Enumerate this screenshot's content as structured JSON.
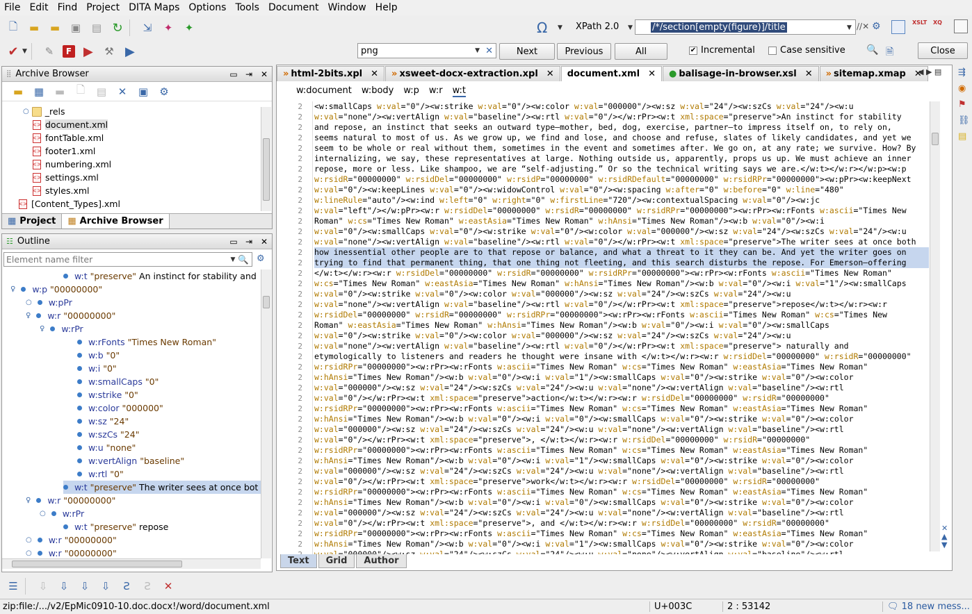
{
  "menu": [
    "File",
    "Edit",
    "Find",
    "Project",
    "DITA Maps",
    "Options",
    "Tools",
    "Document",
    "Window",
    "Help"
  ],
  "toolbar": {
    "xpath_version": "XPath 2.0",
    "xpath_query": "/*/section[empty(figure)]/title"
  },
  "find": {
    "query": "png",
    "next": "Next",
    "previous": "Previous",
    "all": "All",
    "incremental": "Incremental",
    "case_sensitive": "Case sensitive",
    "close": "Close"
  },
  "archive": {
    "title": "Archive Browser",
    "items": [
      "_rels",
      "document.xml",
      "fontTable.xml",
      "footer1.xml",
      "numbering.xml",
      "settings.xml",
      "styles.xml",
      "[Content_Types].xml"
    ],
    "tab_project": "Project",
    "tab_archive": "Archive Browser"
  },
  "outline": {
    "title": "Outline",
    "filter_placeholder": "Element name filter",
    "rows": [
      "w:t \"preserve\" An instinct for stability and",
      "w:p \"00000000\"",
      "w:pPr",
      "w:r \"00000000\"",
      "w:rPr",
      "w:rFonts \"Times New Roman\"",
      "w:b \"0\"",
      "w:i \"0\"",
      "w:smallCaps \"0\"",
      "w:strike \"0\"",
      "w:color \"000000\"",
      "w:sz \"24\"",
      "w:szCs \"24\"",
      "w:u \"none\"",
      "w:vertAlign \"baseline\"",
      "w:rtl \"0\"",
      "w:t \"preserve\" The writer sees at once bot",
      "w:r \"00000000\"",
      "w:rPr",
      "w:t \"preserve\" repose",
      "w:r \"00000000\"",
      "w:r \"00000000\""
    ]
  },
  "editor": {
    "tabs": [
      "html-2bits.xpl",
      "xsweet-docx-extraction.xpl",
      "document.xml",
      "balisage-in-browser.xsl",
      "sitemap.xmap"
    ],
    "breadcrumb": [
      "w:document",
      "w:body",
      "w:p",
      "w:r",
      "w:t"
    ],
    "line_number": "2",
    "mode_tabs": [
      "Text",
      "Grid",
      "Author"
    ],
    "lines": [
      "<w:smallCaps w:val=\"0\"/><w:strike w:val=\"0\"/><w:color w:val=\"000000\"/><w:sz w:val=\"24\"/><w:szCs w:val=\"24\"/><w:u",
      "w:val=\"none\"/><w:vertAlign w:val=\"baseline\"/><w:rtl w:val=\"0\"/></w:rPr><w:t xml:space=\"preserve\">An instinct for stability",
      "and repose, an instinct that seeks an outward type—mother, bed, dog, exercise, partner—to impress itself on, to rely on,",
      "seems natural to most of us. As we grow up, we find and lose, and choose and refuse, slates of likely candidates, and yet we",
      "seem to be whole or real without them, sometimes in the event and sometimes after. We go on, at any rate; we survive. How? By",
      "internalizing, we say, these representatives at large. Nothing outside us, apparently, props us up. We must achieve an inner",
      "repose, more or less. Like shampoo, we are “self-adjusting.” Or so the technical writing says we are.</w:t></w:r></w:p><w:p",
      "w:rsidR=\"00000000\" w:rsidDel=\"00000000\" w:rsidP=\"00000000\" w:rsidRDefault=\"00000000\" w:rsidRPr=\"00000000\"><w:pPr><w:keepNext",
      "w:val=\"0\"/><w:keepLines w:val=\"0\"/><w:widowControl w:val=\"0\"/><w:spacing w:after=\"0\" w:before=\"0\" w:line=\"480\"",
      "w:lineRule=\"auto\"/><w:ind w:left=\"0\" w:right=\"0\" w:firstLine=\"720\"/><w:contextualSpacing w:val=\"0\"/><w:jc",
      "w:val=\"left\"/></w:pPr><w:r w:rsidDel=\"00000000\" w:rsidR=\"00000000\" w:rsidRPr=\"00000000\"><w:rPr><w:rFonts w:ascii=\"Times New",
      "Roman\" w:cs=\"Times New Roman\" w:eastAsia=\"Times New Roman\" w:hAnsi=\"Times New Roman\"/><w:b w:val=\"0\"/><w:i",
      "w:val=\"0\"/><w:smallCaps w:val=\"0\"/><w:strike w:val=\"0\"/><w:color w:val=\"000000\"/><w:sz w:val=\"24\"/><w:szCs w:val=\"24\"/><w:u",
      "w:val=\"none\"/><w:vertAlign w:val=\"baseline\"/><w:rtl w:val=\"0\"/></w:rPr><w:t xml:space=\"preserve\">The writer sees at once both",
      "how inessential other people are to that repose or balance, and what a threat to it they can be. And yet the writer goes on",
      "trying to find that permanent thing, that one thing not fleeting, and this search disturbs the repose. For Emerson—offering",
      "</w:t></w:r><w:r w:rsidDel=\"00000000\" w:rsidR=\"00000000\" w:rsidRPr=\"00000000\"><w:rPr><w:rFonts w:ascii=\"Times New Roman\"",
      "w:cs=\"Times New Roman\" w:eastAsia=\"Times New Roman\" w:hAnsi=\"Times New Roman\"/><w:b w:val=\"0\"/><w:i w:val=\"1\"/><w:smallCaps",
      "w:val=\"0\"/><w:strike w:val=\"0\"/><w:color w:val=\"000000\"/><w:sz w:val=\"24\"/><w:szCs w:val=\"24\"/><w:u",
      "w:val=\"none\"/><w:vertAlign w:val=\"baseline\"/><w:rtl w:val=\"0\"/></w:rPr><w:t xml:space=\"preserve\">repose</w:t></w:r><w:r",
      "w:rsidDel=\"00000000\" w:rsidR=\"00000000\" w:rsidRPr=\"00000000\"><w:rPr><w:rFonts w:ascii=\"Times New Roman\" w:cs=\"Times New",
      "Roman\" w:eastAsia=\"Times New Roman\" w:hAnsi=\"Times New Roman\"/><w:b w:val=\"0\"/><w:i w:val=\"0\"/><w:smallCaps",
      "w:val=\"0\"/><w:strike w:val=\"0\"/><w:color w:val=\"000000\"/><w:sz w:val=\"24\"/><w:szCs w:val=\"24\"/><w:u",
      "w:val=\"none\"/><w:vertAlign w:val=\"baseline\"/><w:rtl w:val=\"0\"/></w:rPr><w:t xml:space=\"preserve\"> naturally and",
      "etymologically to listeners and readers he thought were insane with </w:t></w:r><w:r w:rsidDel=\"00000000\" w:rsidR=\"00000000\"",
      "w:rsidRPr=\"00000000\"><w:rPr><w:rFonts w:ascii=\"Times New Roman\" w:cs=\"Times New Roman\" w:eastAsia=\"Times New Roman\"",
      "w:hAnsi=\"Times New Roman\"/><w:b w:val=\"0\"/><w:i w:val=\"1\"/><w:smallCaps w:val=\"0\"/><w:strike w:val=\"0\"/><w:color",
      "w:val=\"000000\"/><w:sz w:val=\"24\"/><w:szCs w:val=\"24\"/><w:u w:val=\"none\"/><w:vertAlign w:val=\"baseline\"/><w:rtl",
      "w:val=\"0\"/></w:rPr><w:t xml:space=\"preserve\">action</w:t></w:r><w:r w:rsidDel=\"00000000\" w:rsidR=\"00000000\"",
      "w:rsidRPr=\"00000000\"><w:rPr><w:rFonts w:ascii=\"Times New Roman\" w:cs=\"Times New Roman\" w:eastAsia=\"Times New Roman\"",
      "w:hAnsi=\"Times New Roman\"/><w:b w:val=\"0\"/><w:i w:val=\"0\"/><w:smallCaps w:val=\"0\"/><w:strike w:val=\"0\"/><w:color",
      "w:val=\"000000\"/><w:sz w:val=\"24\"/><w:szCs w:val=\"24\"/><w:u w:val=\"none\"/><w:vertAlign w:val=\"baseline\"/><w:rtl",
      "w:val=\"0\"/></w:rPr><w:t xml:space=\"preserve\">, </w:t></w:r><w:r w:rsidDel=\"00000000\" w:rsidR=\"00000000\"",
      "w:rsidRPr=\"00000000\"><w:rPr><w:rFonts w:ascii=\"Times New Roman\" w:cs=\"Times New Roman\" w:eastAsia=\"Times New Roman\"",
      "w:hAnsi=\"Times New Roman\"/><w:b w:val=\"0\"/><w:i w:val=\"1\"/><w:smallCaps w:val=\"0\"/><w:strike w:val=\"0\"/><w:color",
      "w:val=\"000000\"/><w:sz w:val=\"24\"/><w:szCs w:val=\"24\"/><w:u w:val=\"none\"/><w:vertAlign w:val=\"baseline\"/><w:rtl",
      "w:val=\"0\"/></w:rPr><w:t xml:space=\"preserve\">work</w:t></w:r><w:r w:rsidDel=\"00000000\" w:rsidR=\"00000000\"",
      "w:rsidRPr=\"00000000\"><w:rPr><w:rFonts w:ascii=\"Times New Roman\" w:cs=\"Times New Roman\" w:eastAsia=\"Times New Roman\"",
      "w:hAnsi=\"Times New Roman\"/><w:b w:val=\"0\"/><w:i w:val=\"0\"/><w:smallCaps w:val=\"0\"/><w:strike w:val=\"0\"/><w:color",
      "w:val=\"000000\"/><w:sz w:val=\"24\"/><w:szCs w:val=\"24\"/><w:u w:val=\"none\"/><w:vertAlign w:val=\"baseline\"/><w:rtl",
      "w:val=\"0\"/></w:rPr><w:t xml:space=\"preserve\">, and </w:t></w:r><w:r w:rsidDel=\"00000000\" w:rsidR=\"00000000\"",
      "w:rsidRPr=\"00000000\"><w:rPr><w:rFonts w:ascii=\"Times New Roman\" w:cs=\"Times New Roman\" w:eastAsia=\"Times New Roman\"",
      "w:hAnsi=\"Times New Roman\"/><w:b w:val=\"0\"/><w:i w:val=\"1\"/><w:smallCaps w:val=\"0\"/><w:strike w:val=\"0\"/><w:color",
      "w:val=\"000000\"/><w:sz w:val=\"24\"/><w:szCs w:val=\"24\"/><w:u w:val=\"none\"/><w:vertAlign w:val=\"baseline\"/><w:rtl"
    ]
  },
  "status": {
    "path": "zip:file:/.../v2/EpMic0910-10.doc.docx!/word/document.xml",
    "unicode": "U+003C",
    "position": "2 : 53142",
    "messages": "18 new mess..."
  }
}
